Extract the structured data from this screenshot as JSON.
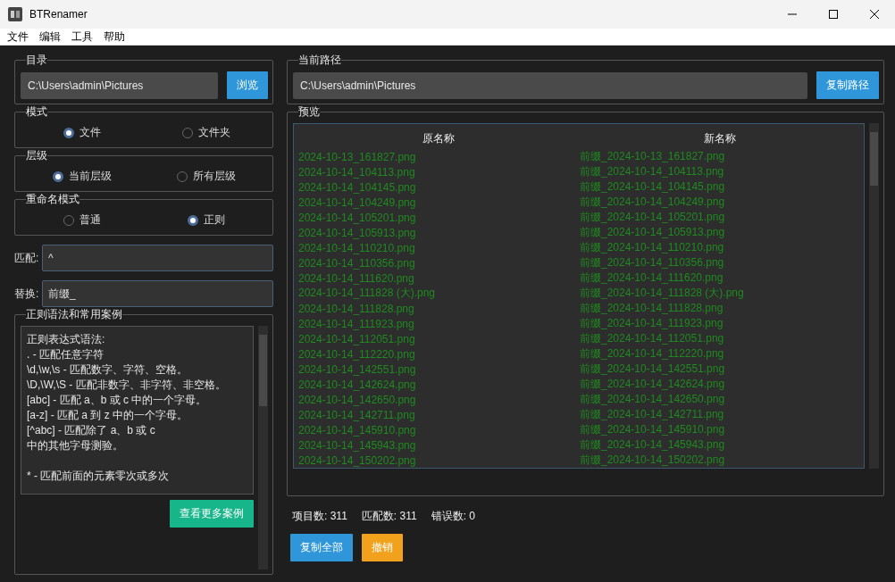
{
  "window": {
    "title": "BTRenamer"
  },
  "menu": [
    "文件",
    "编辑",
    "工具",
    "帮助"
  ],
  "directory": {
    "legend": "目录",
    "value": "C:\\Users\\admin\\Pictures",
    "button": "浏览"
  },
  "radio_groups": [
    {
      "legend": "模式",
      "options": [
        {
          "label": "文件",
          "selected": true
        },
        {
          "label": "文件夹",
          "selected": false
        }
      ]
    },
    {
      "legend": "层级",
      "options": [
        {
          "label": "当前层级",
          "selected": true
        },
        {
          "label": "所有层级",
          "selected": false
        }
      ]
    },
    {
      "legend": "重命名模式",
      "options": [
        {
          "label": "普通",
          "selected": false
        },
        {
          "label": "正则",
          "selected": true
        }
      ]
    }
  ],
  "fields": [
    {
      "label": "匹配:",
      "value": "^"
    },
    {
      "label": "替换:",
      "value": "前缀_"
    }
  ],
  "help": {
    "legend": "正则语法和常用案例",
    "paragraphs": [
      [
        "正则表达式语法:",
        ". - 匹配任意字符",
        "\\d,\\w,\\s - 匹配数字、字符、空格。",
        "\\D,\\W,\\S - 匹配非数字、非字符、非空格。",
        "[abc] - 匹配 a、b 或 c 中的一个字母。",
        "[a-z] - 匹配 a 到 z 中的一个字母。",
        "[^abc] - 匹配除了 a、b 或 c",
        "中的其他字母测验。"
      ],
      [
        "* - 匹配前面的元素零次或多次"
      ]
    ],
    "button": "查看更多案例"
  },
  "current_path": {
    "legend": "当前路径",
    "value": "C:\\Users\\admin\\Pictures",
    "button": "复制路径"
  },
  "preview": {
    "legend": "预览",
    "columns": [
      "原名称",
      "新名称"
    ],
    "rows": [
      [
        "2024-10-13_161827.png",
        "前缀_2024-10-13_161827.png"
      ],
      [
        "2024-10-14_104113.png",
        "前缀_2024-10-14_104113.png"
      ],
      [
        "2024-10-14_104145.png",
        "前缀_2024-10-14_104145.png"
      ],
      [
        "2024-10-14_104249.png",
        "前缀_2024-10-14_104249.png"
      ],
      [
        "2024-10-14_105201.png",
        "前缀_2024-10-14_105201.png"
      ],
      [
        "2024-10-14_105913.png",
        "前缀_2024-10-14_105913.png"
      ],
      [
        "2024-10-14_110210.png",
        "前缀_2024-10-14_110210.png"
      ],
      [
        "2024-10-14_110356.png",
        "前缀_2024-10-14_110356.png"
      ],
      [
        "2024-10-14_111620.png",
        "前缀_2024-10-14_111620.png"
      ],
      [
        "2024-10-14_111828 (大).png",
        "前缀_2024-10-14_111828 (大).png"
      ],
      [
        "2024-10-14_111828.png",
        "前缀_2024-10-14_111828.png"
      ],
      [
        "2024-10-14_111923.png",
        "前缀_2024-10-14_111923.png"
      ],
      [
        "2024-10-14_112051.png",
        "前缀_2024-10-14_112051.png"
      ],
      [
        "2024-10-14_112220.png",
        "前缀_2024-10-14_112220.png"
      ],
      [
        "2024-10-14_142551.png",
        "前缀_2024-10-14_142551.png"
      ],
      [
        "2024-10-14_142624.png",
        "前缀_2024-10-14_142624.png"
      ],
      [
        "2024-10-14_142650.png",
        "前缀_2024-10-14_142650.png"
      ],
      [
        "2024-10-14_142711.png",
        "前缀_2024-10-14_142711.png"
      ],
      [
        "2024-10-14_145910.png",
        "前缀_2024-10-14_145910.png"
      ],
      [
        "2024-10-14_145943.png",
        "前缀_2024-10-14_145943.png"
      ],
      [
        "2024-10-14_150202.png",
        "前缀_2024-10-14_150202.png"
      ]
    ]
  },
  "stats": [
    "项目数: 311",
    "匹配数: 311",
    "错误数: 0"
  ],
  "buttons": [
    {
      "label": "复制全部",
      "kind": "primary"
    },
    {
      "label": "撤销",
      "kind": "warning"
    }
  ]
}
